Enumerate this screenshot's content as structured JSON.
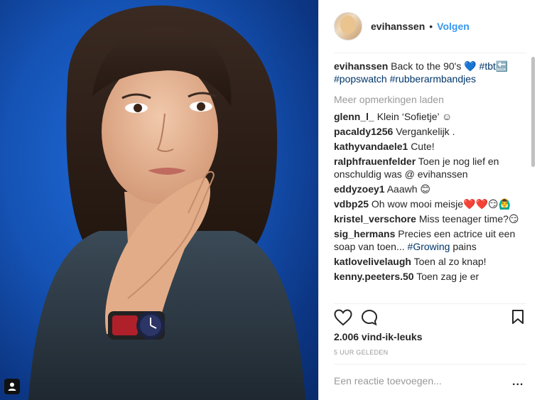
{
  "post": {
    "username": "evihanssen",
    "separator": "•",
    "follow_label": "Volgen",
    "caption": {
      "username": "evihanssen",
      "text": "Back to the 90's 💙",
      "tags": [
        "#tbt🔙",
        "#popswatch",
        "#rubberarmbandjes"
      ]
    },
    "load_more_label": "Meer opmerkingen laden",
    "comments": [
      {
        "user": "glenn_l_",
        "text": "Klein ‘Sofietje’ ☺"
      },
      {
        "user": "pacaldy1256",
        "text": "Vergankelijk ."
      },
      {
        "user": "kathyvandaele1",
        "text": "Cute!"
      },
      {
        "user": "ralphfrauenfelder",
        "text": "Toen je nog lief en onschuldig was @ evihanssen"
      },
      {
        "user": "eddyzoey1",
        "text": "Aaawh 😊"
      },
      {
        "user": "vdbp25",
        "text": "Oh wow mooi meisje❤️❤️😏🙆‍♂️"
      },
      {
        "user": "kristel_verschore",
        "text": "Miss teenager time?😏"
      },
      {
        "user": "sig_hermans",
        "text": "Precies een actrice uit een soap van toen...",
        "tag": "#Growing",
        "after": " pains"
      },
      {
        "user": "katlovelivelaugh",
        "text": "Toen al zo knap!"
      },
      {
        "user": "kenny.peeters.50",
        "text": "Toen zag je er"
      }
    ],
    "likes_label": "2.006 vind-ik-leuks",
    "time_label": "5 UUR GELEDEN",
    "add_comment_placeholder": "Een reactie toevoegen...",
    "more_options_label": "..."
  },
  "colors": {
    "link_blue": "#3897f0",
    "hashtag": "#003569",
    "muted": "#999999",
    "text": "#262626",
    "photo_background": "#1553b5"
  },
  "icons": [
    "heart-icon",
    "comment-icon",
    "bookmark-icon",
    "user-tag-icon"
  ]
}
